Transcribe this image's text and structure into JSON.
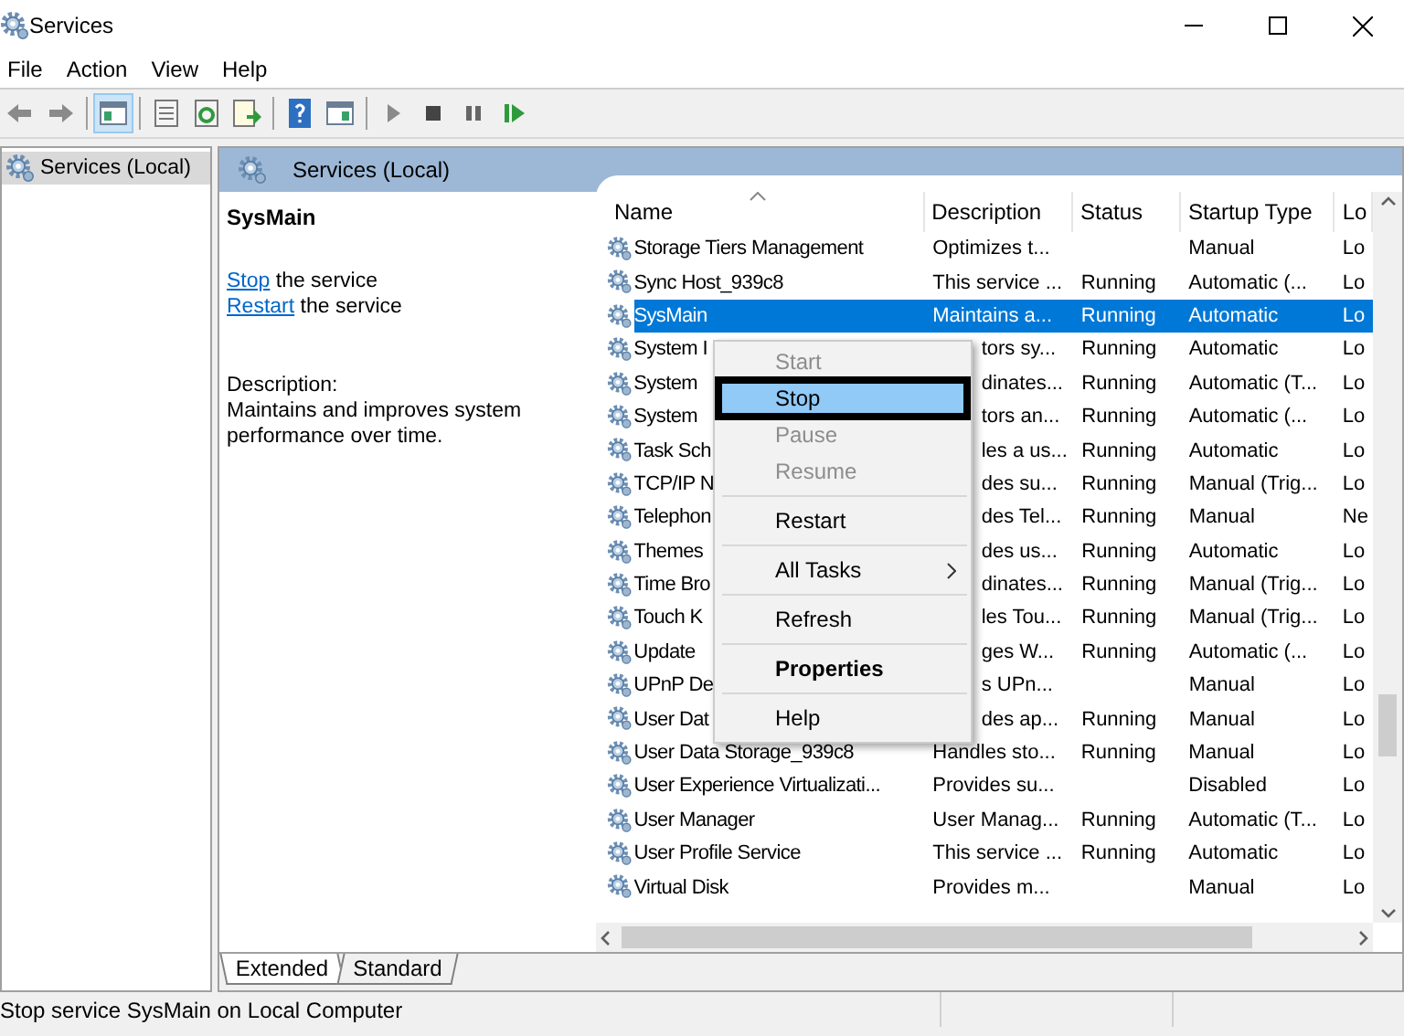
{
  "window": {
    "title": "Services"
  },
  "menu_bar": [
    "File",
    "Action",
    "View",
    "Help"
  ],
  "toolbar": [
    {
      "kind": "back",
      "selected": false
    },
    {
      "kind": "forward",
      "selected": false
    },
    {
      "kind": "separator"
    },
    {
      "kind": "tree",
      "selected": true
    },
    {
      "kind": "separator"
    },
    {
      "kind": "list",
      "selected": false
    },
    {
      "kind": "refresh",
      "selected": false
    },
    {
      "kind": "export",
      "selected": false
    },
    {
      "kind": "separator"
    },
    {
      "kind": "help",
      "selected": false
    },
    {
      "kind": "pane",
      "selected": false
    },
    {
      "kind": "separator"
    },
    {
      "kind": "play",
      "selected": false
    },
    {
      "kind": "stop",
      "selected": false
    },
    {
      "kind": "pause",
      "selected": false
    },
    {
      "kind": "resume",
      "selected": false
    }
  ],
  "tree": {
    "items": [
      {
        "label": "Services (Local)",
        "selected": true
      }
    ]
  },
  "panel": {
    "title": "Services (Local)"
  },
  "details": {
    "service_name": "SysMain",
    "actions": [
      {
        "link": "Stop",
        "text": "the service"
      },
      {
        "link": "Restart",
        "text": "the service"
      }
    ],
    "description_label": "Description:",
    "description": "Maintains and improves system performance over time."
  },
  "table": {
    "columns": [
      {
        "label": "Name",
        "sorted": true
      },
      {
        "label": "Description",
        "sorted": false
      },
      {
        "label": "Status",
        "sorted": false
      },
      {
        "label": "Startup Type",
        "sorted": false
      },
      {
        "label": "Lo",
        "sorted": false
      }
    ],
    "rows": [
      {
        "kind": "full",
        "name": "Storage Tiers Management",
        "description": "Optimizes t...",
        "startup_type": "Manual",
        "log_on_as": "Lo",
        "selected": false
      },
      {
        "kind": "full",
        "name": "Sync Host_939c8",
        "description": "This service ...",
        "status": "Running",
        "startup_type": "Automatic (...",
        "log_on_as": "Lo",
        "selected": false
      },
      {
        "kind": "full",
        "name": "SysMain",
        "description": "Maintains a...",
        "status": "Running",
        "startup_type": "Automatic",
        "log_on_as": "Lo",
        "selected": true
      },
      {
        "kind": "covered",
        "name": "System I",
        "description": "tors sy...",
        "status": "Running",
        "startup_type": "Automatic",
        "log_on_as": "Lo",
        "selected": false
      },
      {
        "kind": "covered",
        "name": "System",
        "description": "dinates...",
        "status": "Running",
        "startup_type": "Automatic (T...",
        "log_on_as": "Lo",
        "selected": false
      },
      {
        "kind": "covered",
        "name": "System",
        "description": "tors an...",
        "status": "Running",
        "startup_type": "Automatic (...",
        "log_on_as": "Lo",
        "selected": false
      },
      {
        "kind": "covered",
        "name": "Task Sch",
        "description": "les a us...",
        "status": "Running",
        "startup_type": "Automatic",
        "log_on_as": "Lo",
        "selected": false
      },
      {
        "kind": "covered",
        "name": "TCP/IP N",
        "description": "des su...",
        "status": "Running",
        "startup_type": "Manual (Trig...",
        "log_on_as": "Lo",
        "selected": false
      },
      {
        "kind": "covered",
        "name": "Telephon",
        "description": "des Tel...",
        "status": "Running",
        "startup_type": "Manual",
        "log_on_as": "Ne",
        "selected": false
      },
      {
        "kind": "covered",
        "name": "Themes",
        "description": "des us...",
        "status": "Running",
        "startup_type": "Automatic",
        "log_on_as": "Lo",
        "selected": false
      },
      {
        "kind": "covered",
        "name": "Time Bro",
        "description": "dinates...",
        "status": "Running",
        "startup_type": "Manual (Trig...",
        "log_on_as": "Lo",
        "selected": false
      },
      {
        "kind": "covered",
        "name": "Touch K",
        "description": "les Tou...",
        "status": "Running",
        "startup_type": "Manual (Trig...",
        "log_on_as": "Lo",
        "selected": false
      },
      {
        "kind": "covered",
        "name": "Update",
        "description": "ges W...",
        "status": "Running",
        "startup_type": "Automatic (...",
        "log_on_as": "Lo",
        "selected": false
      },
      {
        "kind": "covered",
        "name": "UPnP De",
        "description": "s UPn...",
        "startup_type": "Manual",
        "log_on_as": "Lo",
        "selected": false
      },
      {
        "kind": "covered",
        "name": "User Dat",
        "description": "des ap...",
        "status": "Running",
        "startup_type": "Manual",
        "log_on_as": "Lo",
        "selected": false
      },
      {
        "kind": "full",
        "name": "User Data Storage_939c8",
        "description": "Handles sto...",
        "status": "Running",
        "startup_type": "Manual",
        "log_on_as": "Lo",
        "selected": false
      },
      {
        "kind": "full",
        "name": "User Experience Virtualizati...",
        "description": "Provides su...",
        "startup_type": "Disabled",
        "log_on_as": "Lo",
        "selected": false
      },
      {
        "kind": "full",
        "name": "User Manager",
        "description": "User Manag...",
        "status": "Running",
        "startup_type": "Automatic (T...",
        "log_on_as": "Lo",
        "selected": false
      },
      {
        "kind": "full",
        "name": "User Profile Service",
        "description": "This service ...",
        "status": "Running",
        "startup_type": "Automatic",
        "log_on_as": "Lo",
        "selected": false
      },
      {
        "kind": "full",
        "name": "Virtual Disk",
        "description": "Provides m...",
        "startup_type": "Manual",
        "log_on_as": "Lo",
        "selected": false
      }
    ]
  },
  "context_menu": {
    "items": [
      {
        "kind": "item",
        "label": "Start",
        "disabled": true,
        "selected": false,
        "default": false
      },
      {
        "kind": "item",
        "label": "Stop",
        "disabled": false,
        "selected": true,
        "default": false
      },
      {
        "kind": "item",
        "label": "Pause",
        "disabled": true,
        "selected": false,
        "default": false
      },
      {
        "kind": "item",
        "label": "Resume",
        "disabled": true,
        "selected": false,
        "default": false
      },
      {
        "kind": "separator"
      },
      {
        "kind": "item",
        "label": "Restart",
        "disabled": false,
        "selected": false,
        "default": false
      },
      {
        "kind": "separator"
      },
      {
        "kind": "submenu",
        "label": "All Tasks",
        "disabled": false,
        "selected": false,
        "default": false
      },
      {
        "kind": "separator"
      },
      {
        "kind": "item",
        "label": "Refresh",
        "disabled": false,
        "selected": false,
        "default": false
      },
      {
        "kind": "separator"
      },
      {
        "kind": "item",
        "label": "Properties",
        "disabled": false,
        "selected": false,
        "default": true
      },
      {
        "kind": "separator"
      },
      {
        "kind": "item",
        "label": "Help",
        "disabled": false,
        "selected": false,
        "default": false
      }
    ]
  },
  "view_tabs": [
    {
      "label": "Extended",
      "selected": true
    },
    {
      "label": "Standard",
      "selected": false
    }
  ],
  "status_bar": {
    "text": "Stop service SysMain on Local Computer"
  }
}
